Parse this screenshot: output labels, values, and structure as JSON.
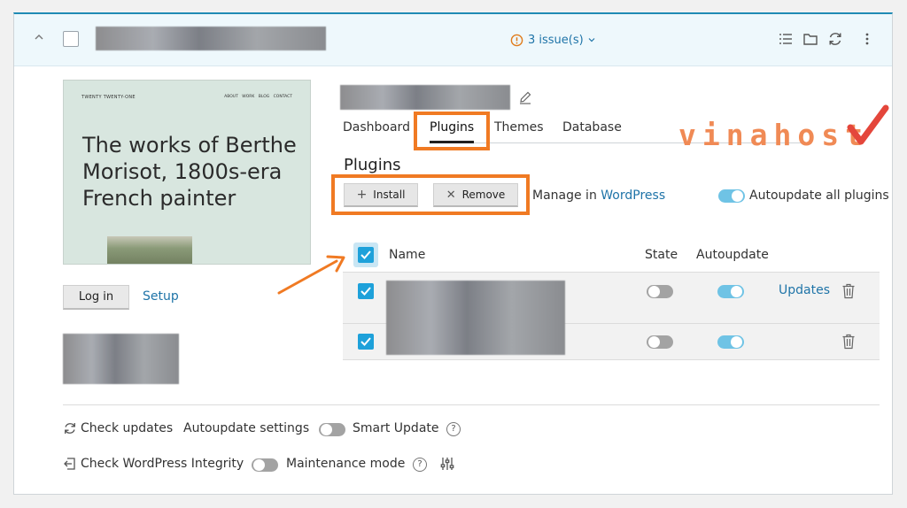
{
  "header": {
    "issues_label": "3 issue(s)",
    "issues_color": "#e07b1a"
  },
  "preview": {
    "site_title": "TWENTY TWENTY-ONE",
    "nav": "ABOUT WORK BLOG CONTACT",
    "headline": "The works of Berthe Morisot, 1800s-era French painter"
  },
  "actions": {
    "login_label": "Log in",
    "setup_label": "Setup"
  },
  "tabs": [
    {
      "label": "Dashboard"
    },
    {
      "label": "Plugins",
      "active": true
    },
    {
      "label": "Themes"
    },
    {
      "label": "Database"
    }
  ],
  "watermark": "vinahost",
  "plugins": {
    "title": "Plugins",
    "install_label": "Install",
    "remove_label": "Remove",
    "manage_prefix": "Manage in ",
    "manage_link": "WordPress",
    "autoupdate_all_label": "Autoupdate all plugins",
    "autoupdate_all_on": true,
    "columns": {
      "name": "Name",
      "state": "State",
      "autoupdate": "Autoupdate"
    },
    "rows": [
      {
        "checked": true,
        "state_on": false,
        "autoupdate_on": true,
        "action": "Updates"
      },
      {
        "checked": true,
        "state_on": false,
        "autoupdate_on": true,
        "action": ""
      }
    ]
  },
  "footer": {
    "check_updates": "Check updates",
    "autoupdate_settings": "Autoupdate settings",
    "smart_update": "Smart Update",
    "check_integrity": "Check WordPress Integrity",
    "maintenance_mode": "Maintenance mode"
  },
  "colors": {
    "accent": "#1f74a8",
    "checkbox": "#1ea1da",
    "highlight": "#f07a23"
  }
}
